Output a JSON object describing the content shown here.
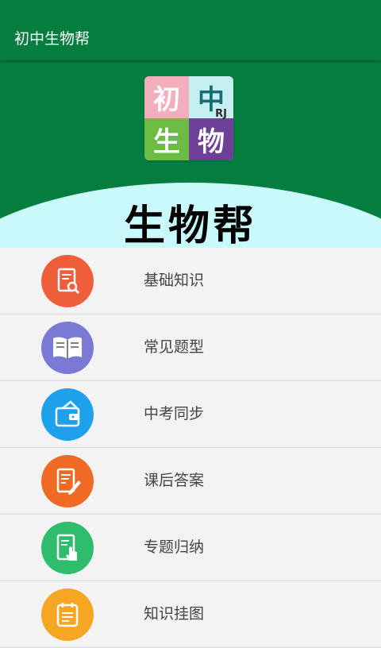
{
  "appbar": {
    "title": "初中生物帮"
  },
  "hero": {
    "logo": {
      "q1": "初",
      "q2": "中",
      "q3": "生",
      "q4": "物",
      "badge": "RJ"
    },
    "title": "生物帮"
  },
  "menu": {
    "items": [
      {
        "label": "基础知识",
        "icon": "document-search-icon",
        "color": "#ef5e3b"
      },
      {
        "label": "常见题型",
        "icon": "open-book-icon",
        "color": "#7b79d6"
      },
      {
        "label": "中考同步",
        "icon": "wallet-icon",
        "color": "#1ea1ea"
      },
      {
        "label": "课后答案",
        "icon": "document-edit-icon",
        "color": "#ee6a25"
      },
      {
        "label": "专题归纳",
        "icon": "tablet-tap-icon",
        "color": "#2dbd6d"
      },
      {
        "label": "知识挂图",
        "icon": "calendar-list-icon",
        "color": "#f5a623"
      }
    ]
  }
}
